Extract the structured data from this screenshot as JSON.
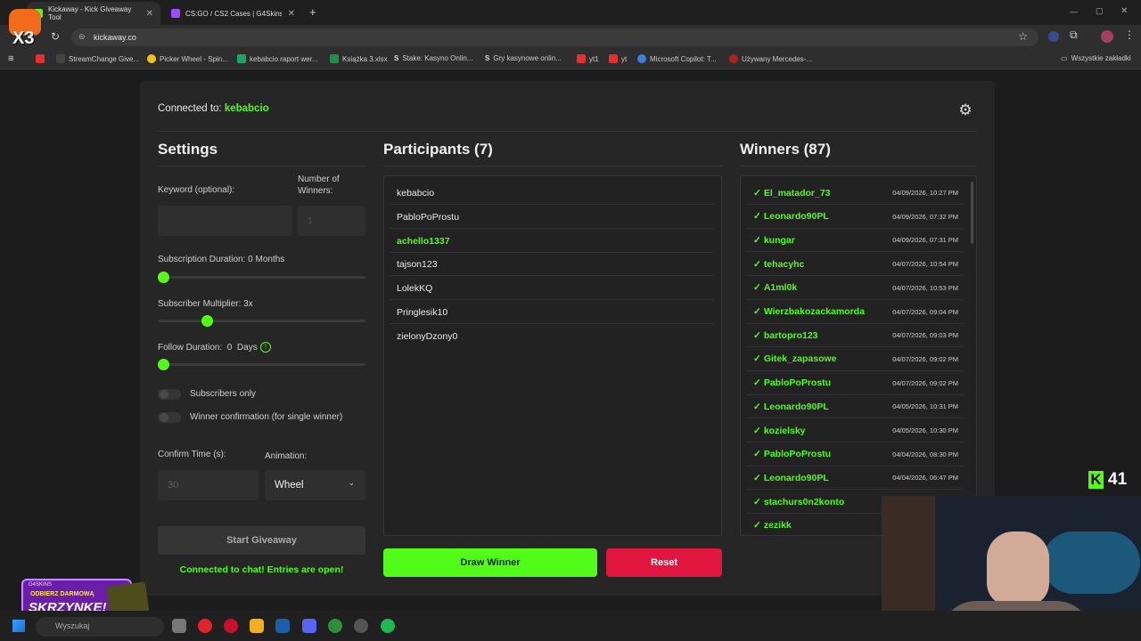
{
  "browser": {
    "tabs": [
      {
        "title": "Kickaway - Kick Giveaway Tool",
        "active": true
      },
      {
        "title": "CS:GO / CS2 Cases | G4Skins Ca",
        "active": false
      }
    ],
    "new_tab": "+",
    "url": "kickaway.co",
    "bookmarks": [
      "StreamChange Give...",
      "Picker Wheel - Spin...",
      "kebabcio raport wer...",
      "Książka 3.xlsx",
      "Stake: Kasyno Onlin...",
      "Gry kasynowe onlin...",
      "yt1",
      "yt",
      "Microsoft Copilot: T...",
      "Używany Mercedes-..."
    ],
    "all_bookmarks": "Wszystkie zakładki"
  },
  "app": {
    "connected_prefix": "Connected to:",
    "channel": "kebabcio",
    "settings": {
      "title": "Settings",
      "keyword_label": "Keyword (optional):",
      "keyword_value": "",
      "winners_label": "Number of Winners:",
      "winners_value": "1",
      "sub_duration_label": "Subscription Duration: 0 Months",
      "sub_duration_value": 0,
      "sub_multiplier_label": "Subscriber Multiplier: 3x",
      "sub_multiplier_value": 0.24,
      "follow_label": "Follow Duration:  0  Days",
      "follow_info": "!",
      "follow_value": 0,
      "subscribers_only": "Subscribers only",
      "winner_confirmation": "Winner confirmation (for single winner)",
      "confirm_time_label": "Confirm Time (s):",
      "confirm_time_value": "30",
      "animation_label": "Animation:",
      "animation_value": "Wheel",
      "start_button": "Start Giveaway",
      "status": "Connected to chat! Entries are open!"
    },
    "participants": {
      "title": "Participants (7)",
      "items": [
        {
          "name": "kebabcio",
          "highlight": false
        },
        {
          "name": "PabloPoProstu",
          "highlight": false
        },
        {
          "name": "achello1337",
          "highlight": true
        },
        {
          "name": "tajson123",
          "highlight": false
        },
        {
          "name": "LolekKQ",
          "highlight": false
        },
        {
          "name": "Pringlesik10",
          "highlight": false
        },
        {
          "name": "zielonyDzony0",
          "highlight": false
        }
      ],
      "draw_button": "Draw Winner",
      "reset_button": "Reset"
    },
    "winners": {
      "title": "Winners (87)",
      "items": [
        {
          "name": "El_matador_73",
          "date": "04/09/2026, 10:27 PM"
        },
        {
          "name": "Leonardo90PL",
          "date": "04/09/2026, 07:32 PM"
        },
        {
          "name": "kungar",
          "date": "04/09/2026, 07:31 PM"
        },
        {
          "name": "tehacyhc",
          "date": "04/07/2026, 10:54 PM"
        },
        {
          "name": "A1ml0k",
          "date": "04/07/2026, 10:53 PM"
        },
        {
          "name": "Wierzbakozackamorda",
          "date": "04/07/2026, 09:04 PM"
        },
        {
          "name": "bartopro123",
          "date": "04/07/2026, 09:03 PM"
        },
        {
          "name": "Gitek_zapasowe",
          "date": "04/07/2026, 09:02 PM"
        },
        {
          "name": "PabloPoProstu",
          "date": "04/07/2026, 09:02 PM"
        },
        {
          "name": "Leonardo90PL",
          "date": "04/05/2026, 10:31 PM"
        },
        {
          "name": "kozielsky",
          "date": "04/05/2026, 10:30 PM"
        },
        {
          "name": "PabloPoProstu",
          "date": "04/04/2026, 08:30 PM"
        },
        {
          "name": "Leonardo90PL",
          "date": "04/04/2026, 06:47 PM"
        },
        {
          "name": "stachurs0n2konto",
          "date": ""
        },
        {
          "name": "zezikk",
          "date": ""
        }
      ]
    }
  },
  "overlay": {
    "badge_count": "X3",
    "kick_count": "41",
    "promo_text_1": "ODBIERZ DARMOWĄ",
    "promo_text_2": "SKRZYNKĘ!",
    "promo_brand": "G4SKINS"
  },
  "taskbar": {
    "search_placeholder": "Wyszukaj"
  },
  "colors": {
    "accent": "#53fc18",
    "reset": "#e0163f",
    "card": "#262626"
  }
}
